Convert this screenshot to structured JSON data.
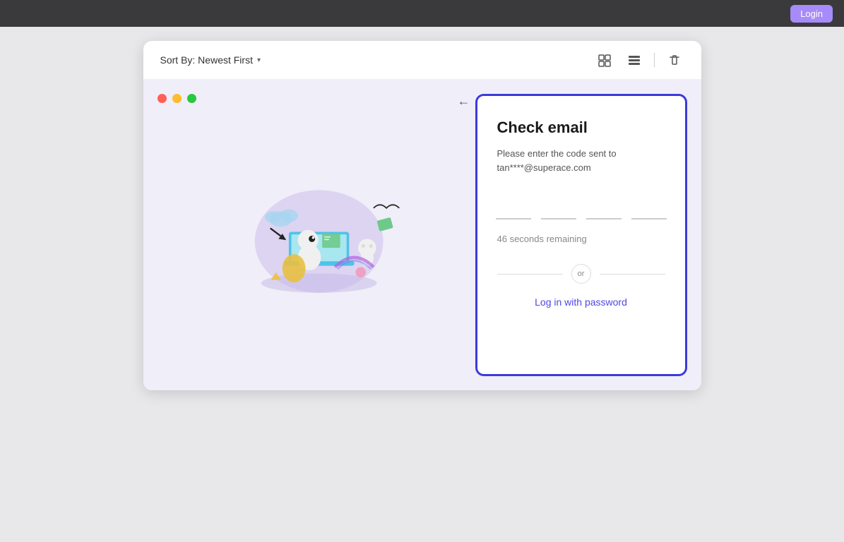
{
  "titlebar": {
    "login_label": "Login"
  },
  "toolbar": {
    "sort_label": "Sort By: Newest First",
    "sort_chevron": "▾",
    "grid_view_icon": "grid-view-icon",
    "list_view_icon": "list-view-icon",
    "delete_icon": "trash-icon"
  },
  "check_email": {
    "title": "Check email",
    "subtitle": "Please enter the code sent to tan****@superace.com",
    "timer": "46 seconds remaining",
    "otp_placeholder_1": "",
    "otp_placeholder_2": "",
    "otp_placeholder_3": "",
    "otp_placeholder_4": "",
    "or_label": "or",
    "log_in_password_label": "Log in with password",
    "back_arrow": "←"
  },
  "colors": {
    "accent": "#4f46e5",
    "border_active": "#3b3bdc",
    "dot_red": "#ff5f57",
    "dot_yellow": "#febc2e",
    "dot_green": "#28c840"
  }
}
